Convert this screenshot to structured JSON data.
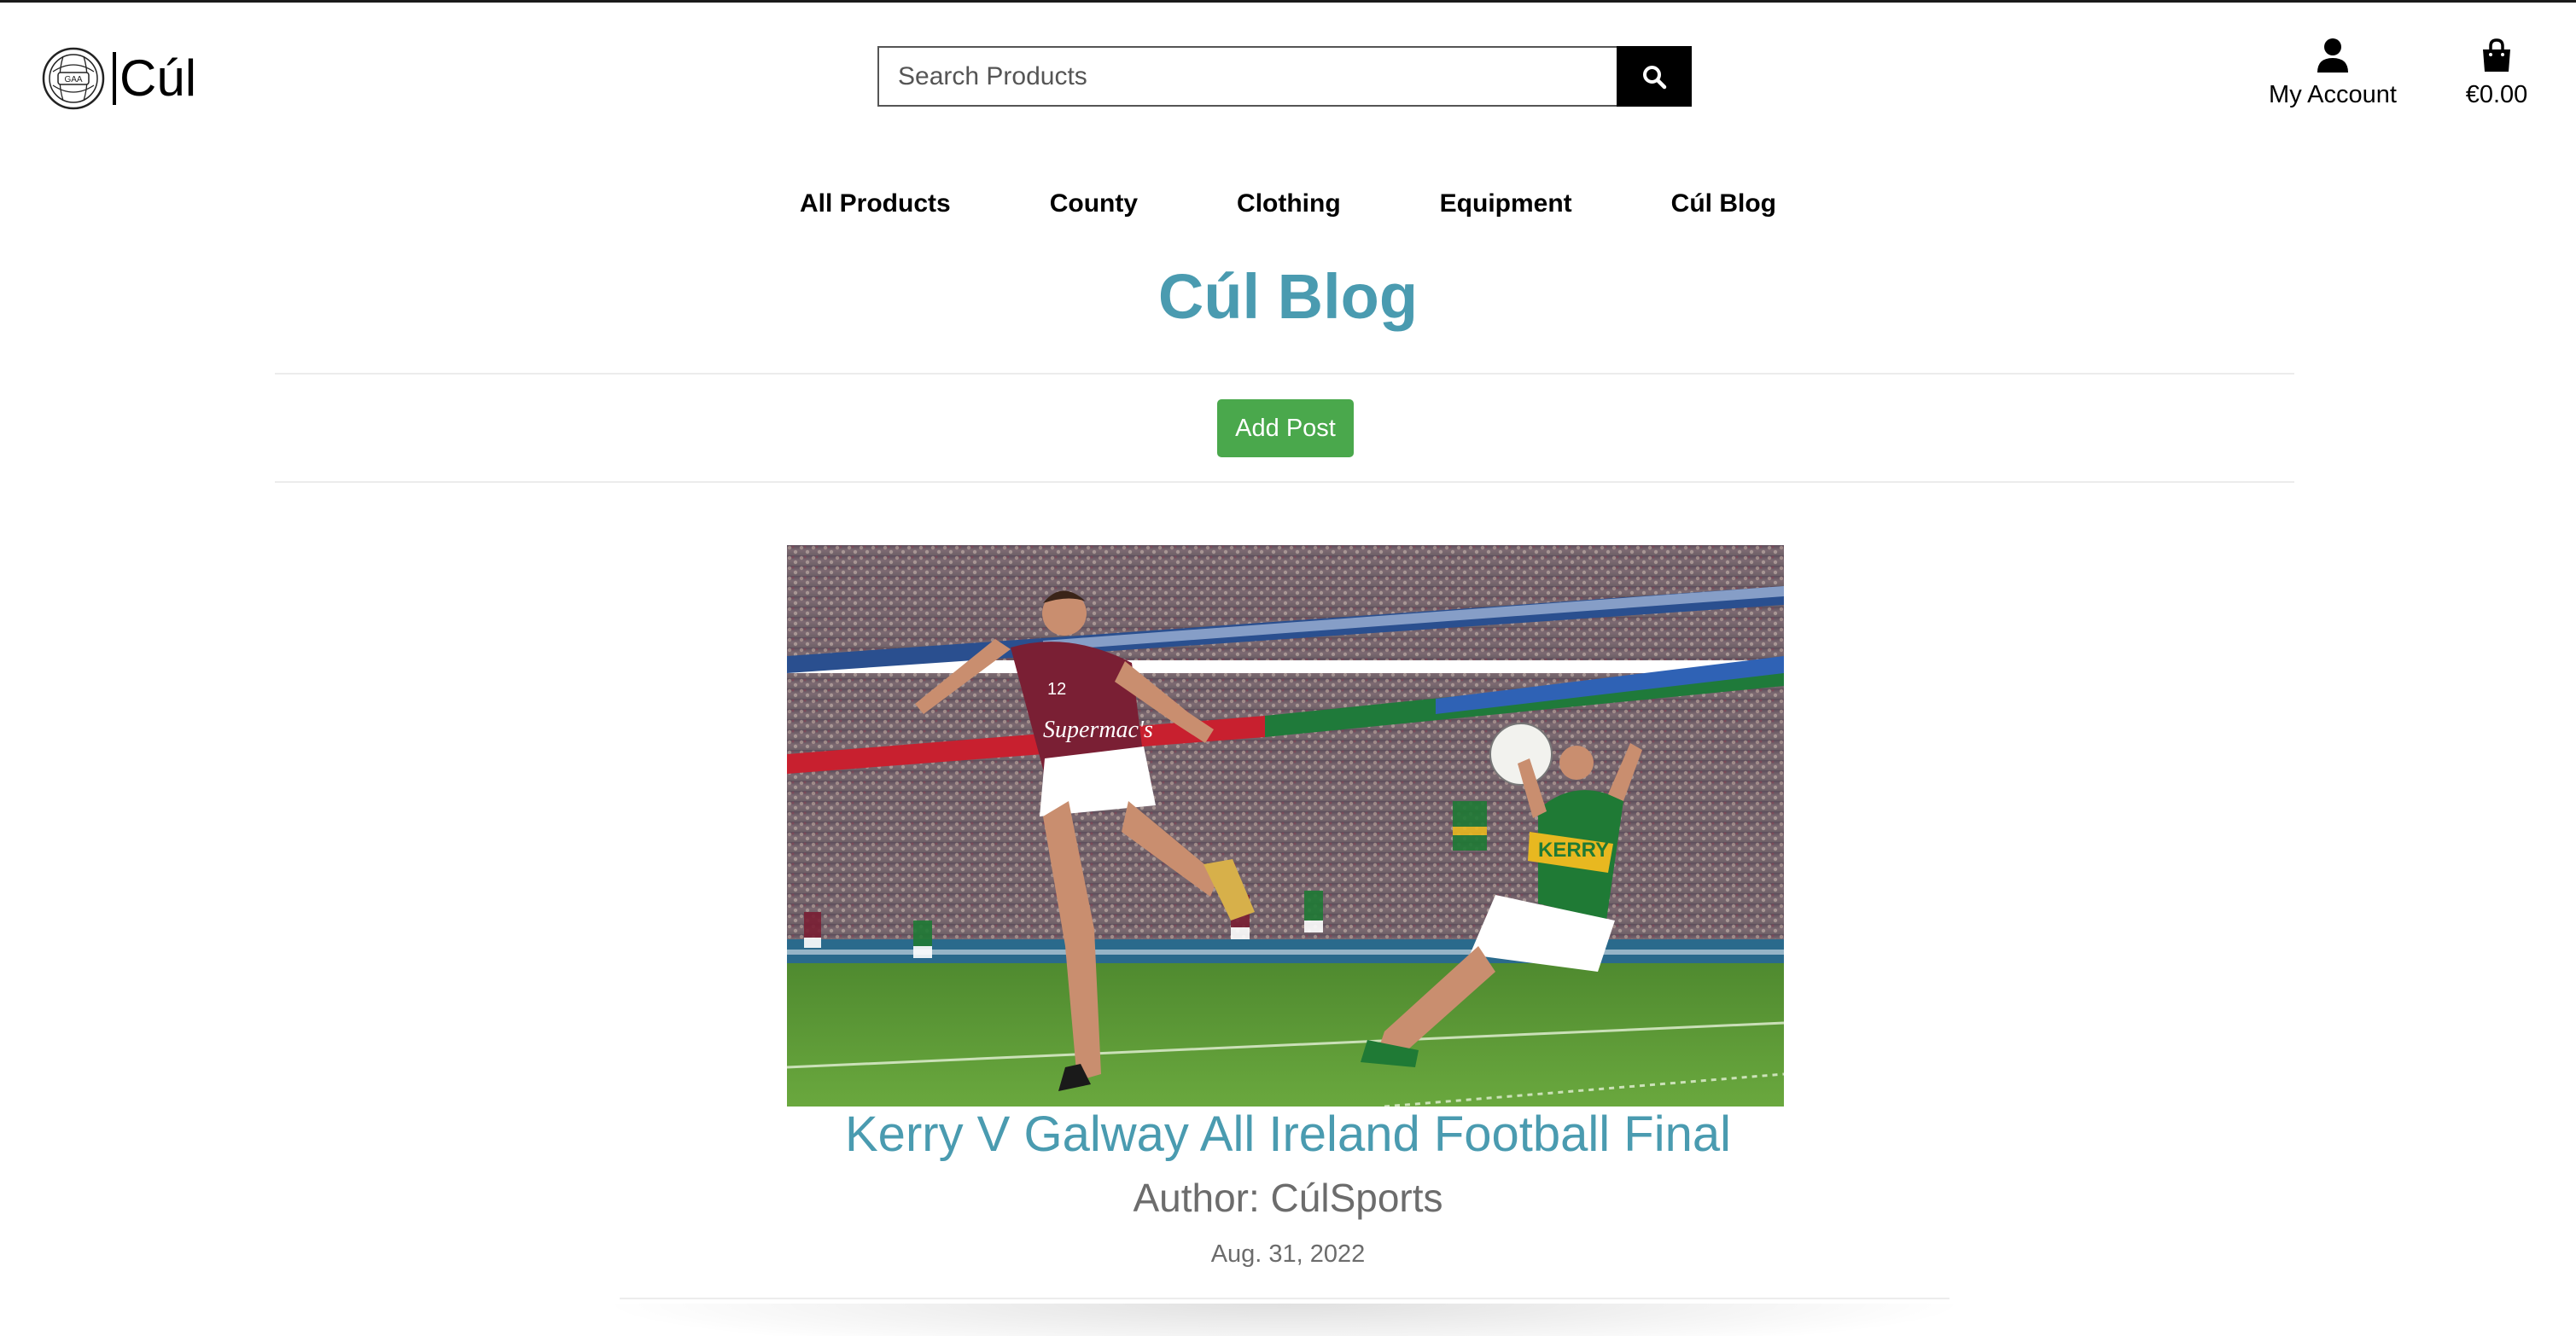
{
  "header": {
    "logo_text": "Cúl",
    "logo_emblem_text": "GAA",
    "search_placeholder": "Search Products",
    "account_label": "My Account",
    "bag_total": "€0.00"
  },
  "nav": {
    "items": [
      {
        "label": "All Products"
      },
      {
        "label": "County"
      },
      {
        "label": "Clothing"
      },
      {
        "label": "Equipment"
      },
      {
        "label": "Cúl Blog"
      }
    ]
  },
  "main": {
    "page_title": "Cúl Blog",
    "add_post_label": "Add Post",
    "post": {
      "title": "Kerry V Galway All Ireland Football Final",
      "author": "Author: CúlSports",
      "date": "Aug. 31, 2022",
      "image_description_icon": "football-match-photo",
      "shirt_text_left": "Supermac's",
      "shirt_number_left": "12",
      "shirt_text_right": "KERRY"
    }
  },
  "colors": {
    "accent": "#4a9bb0",
    "button_green": "#4aa84c",
    "galway_maroon": "#7a1f34",
    "kerry_green": "#1f7a35",
    "kerry_gold": "#e8b820",
    "pitch_green": "#5f9c3a"
  }
}
